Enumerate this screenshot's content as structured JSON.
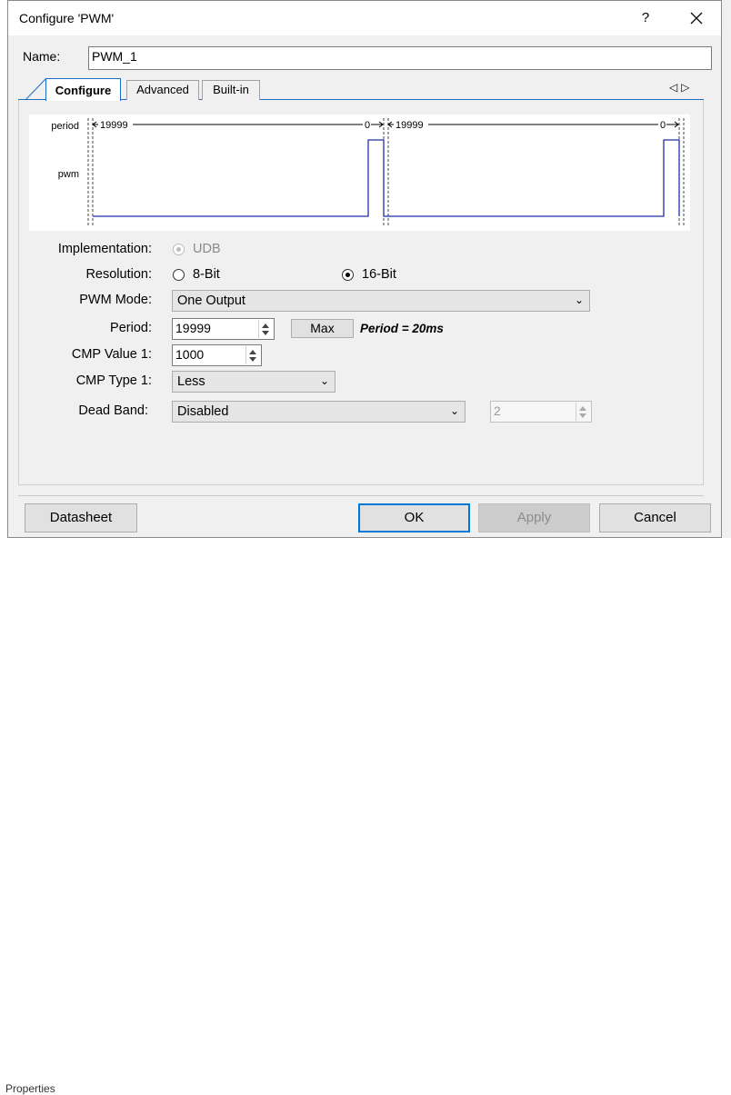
{
  "window": {
    "title": "Configure 'PWM'",
    "help_label": "?"
  },
  "name_field": {
    "label": "Name:",
    "value": "PWM_1"
  },
  "tabs": [
    {
      "label": "Configure",
      "active": true
    },
    {
      "label": "Advanced",
      "active": false
    },
    {
      "label": "Built-in",
      "active": false
    }
  ],
  "tab_scroll": {
    "left": "◁",
    "right": "▷"
  },
  "waveform": {
    "row_labels": {
      "period": "period",
      "pwm": "pwm"
    },
    "period_start": "19999",
    "period_end": "0",
    "colors": {
      "pwm_line": "#1f2fa8",
      "period_line": "#000000"
    }
  },
  "form": {
    "implementation": {
      "label": "Implementation:",
      "option": "UDB"
    },
    "resolution": {
      "label": "Resolution:",
      "options": [
        "8-Bit",
        "16-Bit"
      ],
      "selected": "16-Bit"
    },
    "pwm_mode": {
      "label": "PWM Mode:",
      "value": "One Output"
    },
    "period": {
      "label": "Period:",
      "value": "19999",
      "max_label": "Max",
      "note": "Period = 20ms"
    },
    "cmp_value_1": {
      "label": "CMP Value 1:",
      "value": "1000"
    },
    "cmp_type_1": {
      "label": "CMP Type 1:",
      "value": "Less"
    },
    "dead_band": {
      "label": "Dead Band:",
      "value": "Disabled",
      "spin_value": "2"
    }
  },
  "buttons": {
    "datasheet": "Datasheet",
    "ok": "OK",
    "apply": "Apply",
    "cancel": "Cancel"
  },
  "background": {
    "bottom_text": "Properties"
  }
}
